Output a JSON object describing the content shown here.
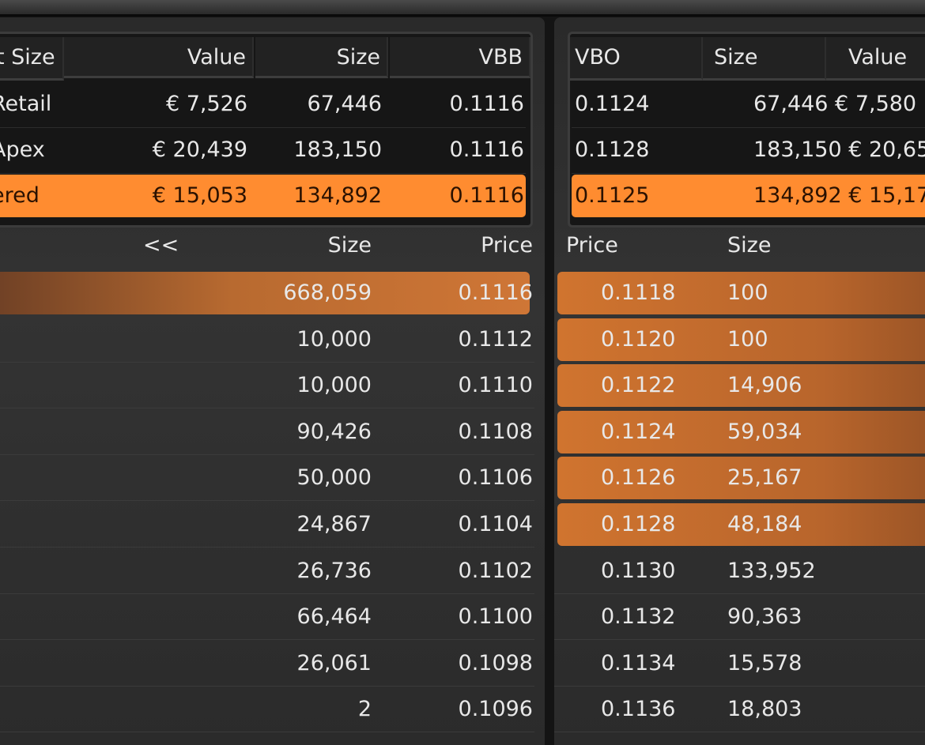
{
  "summary_left": {
    "headers": [
      "t Size",
      "Value",
      "Size",
      "VBB"
    ],
    "rows": [
      {
        "name": "Retail",
        "value": "€ 7,526",
        "size": "67,446",
        "price": "0.1116",
        "highlight": false
      },
      {
        "name": "Apex",
        "value": "€ 20,439",
        "size": "183,150",
        "price": "0.1116",
        "highlight": false
      },
      {
        "name": "ered",
        "value": "€ 15,053",
        "size": "134,892",
        "price": "0.1116",
        "highlight": true
      }
    ]
  },
  "summary_right": {
    "headers": [
      "VBO",
      "Size",
      "Value"
    ],
    "rows": [
      {
        "price": "0.1124",
        "size_value": "67,446 € 7,580",
        "highlight": false
      },
      {
        "price": "0.1128",
        "size_value": "183,150 € 20,65",
        "highlight": false
      },
      {
        "price": "0.1125",
        "size_value": "134,892 € 15,17",
        "highlight": true
      }
    ]
  },
  "bid_book": {
    "headers": {
      "nav": "<<",
      "size": "Size",
      "price": "Price"
    },
    "rows": [
      {
        "size": "668,059",
        "price": "0.1116",
        "highlight": true
      },
      {
        "size": "10,000",
        "price": "0.1112",
        "highlight": false
      },
      {
        "size": "10,000",
        "price": "0.1110",
        "highlight": false
      },
      {
        "size": "90,426",
        "price": "0.1108",
        "highlight": false
      },
      {
        "size": "50,000",
        "price": "0.1106",
        "highlight": false
      },
      {
        "size": "24,867",
        "price": "0.1104",
        "highlight": false
      },
      {
        "size": "26,736",
        "price": "0.1102",
        "highlight": false
      },
      {
        "size": "66,464",
        "price": "0.1100",
        "highlight": false
      },
      {
        "size": "26,061",
        "price": "0.1098",
        "highlight": false
      },
      {
        "size": "2",
        "price": "0.1096",
        "highlight": false
      }
    ]
  },
  "ask_book": {
    "headers": {
      "price": "Price",
      "size": "Size"
    },
    "rows": [
      {
        "price": "0.1118",
        "size": "100",
        "highlight": true
      },
      {
        "price": "0.1120",
        "size": "100",
        "highlight": true
      },
      {
        "price": "0.1122",
        "size": "14,906",
        "highlight": true
      },
      {
        "price": "0.1124",
        "size": "59,034",
        "highlight": true
      },
      {
        "price": "0.1126",
        "size": "25,167",
        "highlight": true
      },
      {
        "price": "0.1128",
        "size": "48,184",
        "highlight": true
      },
      {
        "price": "0.1130",
        "size": "133,952",
        "highlight": false
      },
      {
        "price": "0.1132",
        "size": "90,363",
        "highlight": false
      },
      {
        "price": "0.1134",
        "size": "15,578",
        "highlight": false
      },
      {
        "price": "0.1136",
        "size": "18,803",
        "highlight": false
      }
    ]
  },
  "colors": {
    "accent": "#ff8c30",
    "bar": "#c8712f",
    "background": "#2f2f2f"
  }
}
